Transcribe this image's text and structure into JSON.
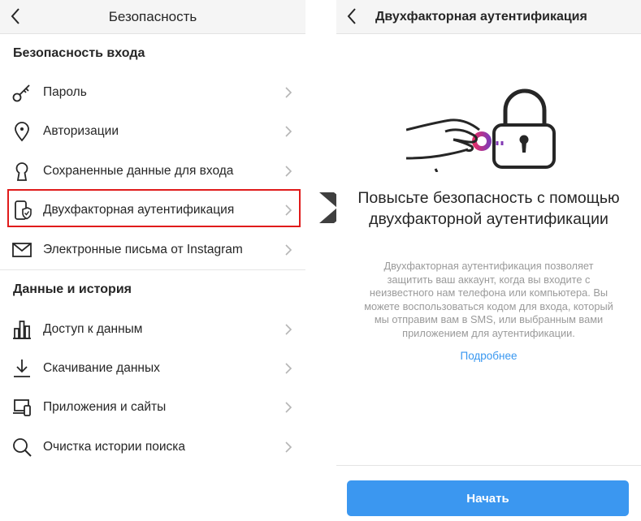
{
  "left": {
    "title": "Безопасность",
    "sections": [
      {
        "header": "Безопасность входа",
        "items": [
          {
            "label": "Пароль",
            "icon": "key-icon"
          },
          {
            "label": "Авторизации",
            "icon": "location-pin-icon"
          },
          {
            "label": "Сохраненные данные для входа",
            "icon": "keyhole-icon"
          },
          {
            "label": "Двухфакторная аутентификация",
            "icon": "phone-shield-icon"
          },
          {
            "label": "Электронные письма от Instagram",
            "icon": "envelope-icon"
          }
        ]
      },
      {
        "header": "Данные и история",
        "items": [
          {
            "label": "Доступ к данным",
            "icon": "bar-chart-icon"
          },
          {
            "label": "Скачивание данных",
            "icon": "download-icon"
          },
          {
            "label": "Приложения и сайты",
            "icon": "devices-icon"
          },
          {
            "label": "Очистка истории поиска",
            "icon": "search-icon"
          }
        ]
      }
    ]
  },
  "right": {
    "title": "Двухфакторная аутентификация",
    "headline": "Повысьте безопасность с помощью двухфакторной аутентификации",
    "description": "Двухфакторная аутентификация позволяет защитить ваш аккаунт, когда вы входите с неизвестного нам телефона или компьютера. Вы можете воспользоваться кодом для входа, который мы отправим вам в SMS, или выбранным вами приложением для аутентификации.",
    "learn_more": "Подробнее",
    "start_button": "Начать"
  },
  "colors": {
    "accent": "#3897f0",
    "button": "#3b97f0",
    "highlight": "#e01b1b",
    "key_gradient": [
      "#e1306c",
      "#833ab4"
    ]
  }
}
